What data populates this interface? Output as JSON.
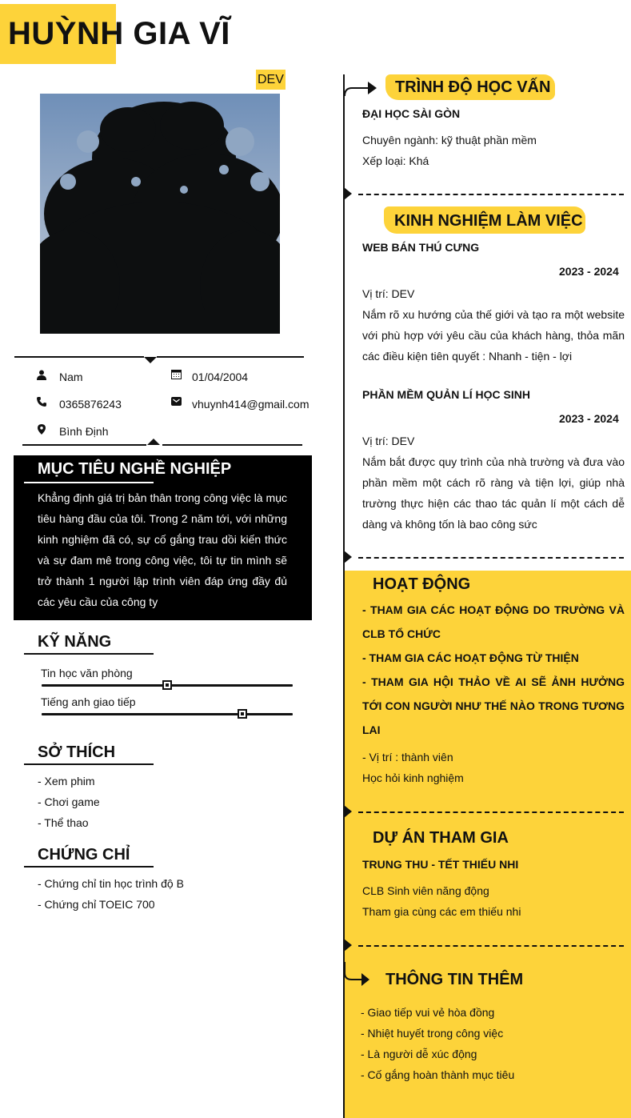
{
  "header": {
    "name_part1": "HUỲNH",
    "name_part2": " GIA VĨ",
    "role": "DEV"
  },
  "contact": {
    "gender": "Nam",
    "birthday": "01/04/2004",
    "phone": "0365876243",
    "email": "vhuynh414@gmail.com",
    "address": "Bình Định"
  },
  "objective": {
    "title": "MỤC TIÊU NGHỀ NGHIỆP",
    "text": "Khẳng định giá trị bản thân trong công việc là mục tiêu hàng đầu của tôi. Trong 2 năm tới, với những kinh nghiệm đã có, sự cố gắng trau dồi kiến thức và sự đam mê trong công việc, tôi tự tin mình sẽ trở thành 1 người lập trình viên đáp ứng đầy đủ các yêu cầu của công ty"
  },
  "skills": {
    "title": "KỸ NĂNG",
    "items": [
      {
        "label": "Tin học văn phòng",
        "level": 0.5
      },
      {
        "label": "Tiếng anh giao tiếp",
        "level": 0.8
      }
    ]
  },
  "hobbies": {
    "title": "SỞ THÍCH",
    "items": [
      "- Xem phim",
      "- Chơi game",
      "- Thể thao"
    ]
  },
  "certificates": {
    "title": "CHỨNG CHỈ",
    "items": [
      "- Chứng chỉ tin học trình độ B",
      "- Chứng chỉ TOEIC 700"
    ]
  },
  "education": {
    "title": "TRÌNH ĐỘ HỌC VẤN",
    "school": "ĐẠI HỌC SÀI GÒN",
    "major": "Chuyên ngành: kỹ thuật phần mềm",
    "grade": "Xếp loại: Khá"
  },
  "experience": {
    "title": "KINH NGHIỆM LÀM VIỆC",
    "jobs": [
      {
        "name": "WEB BÁN THÚ CƯNG",
        "period": "2023 - 2024",
        "position": "Vị trí: DEV",
        "description": "Nắm rõ xu hướng của thế giới và tạo ra một website với phù hợp với yêu cầu của khách hàng, thỏa mãn các điều kiện tiên quyết : Nhanh - tiện - lợi"
      },
      {
        "name": "PHẦN MỀM QUẢN LÍ HỌC SINH",
        "period": "2023 - 2024",
        "position": "Vị trí: DEV",
        "description": "Nắm bắt được quy trình của nhà trường và đưa vào phần mềm một cách rõ ràng và tiện lợi, giúp nhà trường thực hiện các thao tác quản lí một cách dễ dàng và không tốn là bao công sức"
      }
    ]
  },
  "activities": {
    "title": "HOẠT ĐỘNG",
    "items": [
      "- THAM GIA CÁC HOẠT ĐỘNG DO TRƯỜNG VÀ CLB TỔ CHỨC",
      "- THAM GIA CÁC HOẠT ĐỘNG TỪ THIỆN",
      "- THAM GIA HỘI THẢO VỀ AI SẼ ẢNH HƯỞNG TỚI CON NGƯỜI NHƯ THẾ NÀO TRONG TƯƠNG LAI"
    ],
    "position": "- Vị trí : thành viên",
    "note": "Học hỏi kinh nghiệm"
  },
  "projects": {
    "title": "DỰ ÁN THAM GIA",
    "name": "TRUNG THU - TẾT THIẾU NHI",
    "org": "CLB Sinh viên năng động",
    "desc": "Tham gia cùng các em thiếu nhi"
  },
  "extra": {
    "title": "THÔNG TIN THÊM",
    "items": [
      "- Giao tiếp vui vẻ hòa đồng",
      "- Nhiệt huyết trong công việc",
      "- Là người dễ xúc động",
      "- Cố gắng hoàn thành mục tiêu"
    ]
  },
  "colors": {
    "accent": "#fdd33a",
    "text": "#111111",
    "objective_bg": "#000000"
  },
  "icons": [
    "user-icon",
    "calendar-icon",
    "phone-icon",
    "email-icon",
    "location-icon",
    "arrow-right-icon"
  ]
}
